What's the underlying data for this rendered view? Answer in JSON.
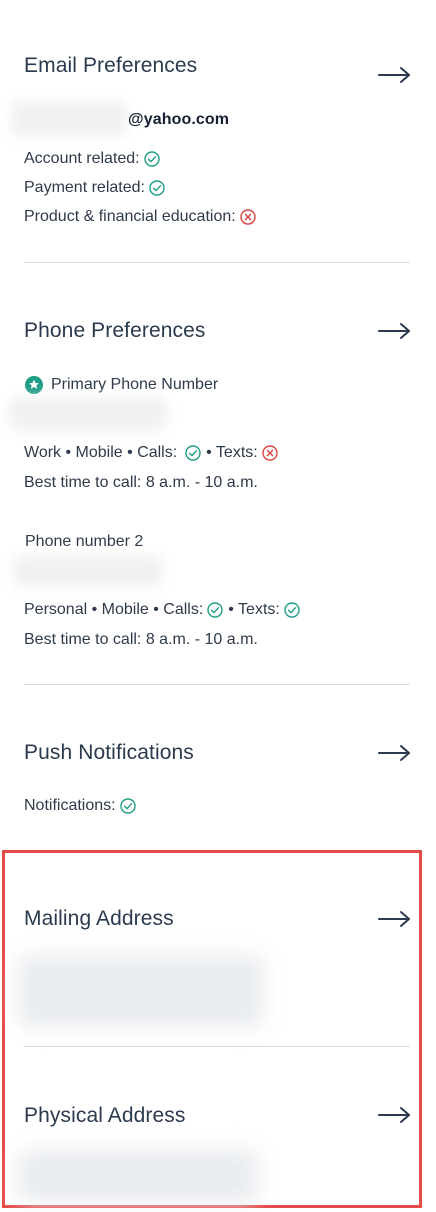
{
  "email": {
    "title": "Email Preferences",
    "address_domain": "@yahoo.com",
    "rows": [
      {
        "label": "Account related:",
        "status": "yes"
      },
      {
        "label": "Payment related:",
        "status": "yes"
      },
      {
        "label": "Product & financial education:",
        "status": "no"
      }
    ]
  },
  "phone": {
    "title": "Phone Preferences",
    "primary_label": "Primary Phone Number",
    "primary": {
      "type_line": "Work • Mobile • Calls:",
      "texts_label": "• Texts:",
      "calls_status": "yes",
      "texts_status": "no",
      "best_time": "Best time to call: 8 a.m. - 10 a.m."
    },
    "second_label": "Phone number 2",
    "second": {
      "type_line": "Personal • Mobile • Calls:",
      "texts_label": "• Texts:",
      "calls_status": "yes",
      "texts_status": "yes",
      "best_time": "Best time to call: 8 a.m. - 10 a.m."
    }
  },
  "push": {
    "title": "Push Notifications",
    "row": {
      "label": "Notifications:",
      "status": "yes"
    }
  },
  "mailing": {
    "title": "Mailing Address"
  },
  "physical": {
    "title": "Physical Address"
  },
  "colors": {
    "check": "#1f9e87",
    "cross": "#d9453e",
    "star_badge": "#1f9e87",
    "highlight_border": "#e64a4a",
    "title_text": "#2c3a4f",
    "body_text": "#2f3a4a"
  },
  "icons": {
    "yes": "check-circle-icon",
    "no": "x-circle-icon",
    "arrow": "arrow-right-icon",
    "star": "star-badge-icon"
  }
}
